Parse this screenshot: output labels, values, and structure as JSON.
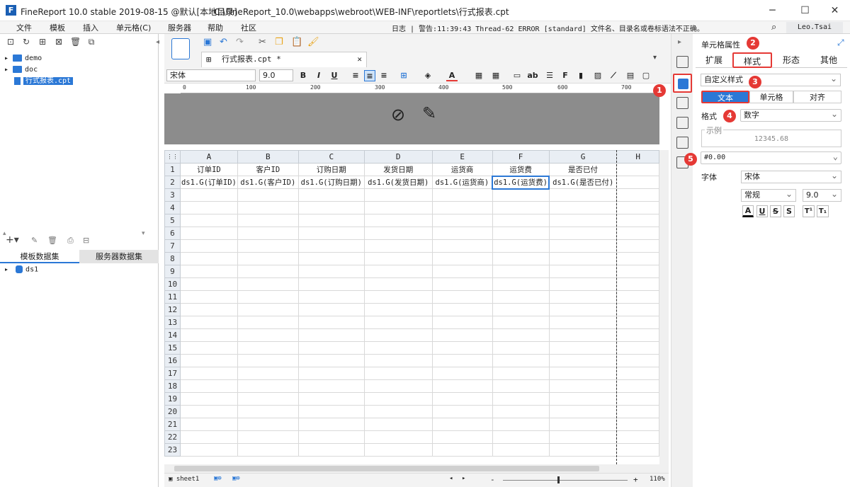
{
  "window": {
    "title": "FineReport 10.0 stable 2019-08-15 @默认[本地目录]",
    "path": "C:\\FineReport_10.0\\webapps\\webroot\\WEB-INF\\reportlets\\行式报表.cpt",
    "minimize": "─",
    "maximize": "☐",
    "close": "✕"
  },
  "menu": [
    "文件",
    "模板",
    "插入",
    "单元格(C)",
    "服务器",
    "帮助",
    "社区"
  ],
  "log": {
    "label": "日志",
    "message": "警告:11:39:43 Thread-62 ERROR [standard] 文件名、目录名或卷标语法不正确。"
  },
  "user": "Leo.Tsai",
  "tree": {
    "items": [
      {
        "label": "demo",
        "type": "folder"
      },
      {
        "label": "doc",
        "type": "folder"
      },
      {
        "label": "行式报表.cpt",
        "type": "file"
      }
    ]
  },
  "dataset_tabs": [
    "模板数据集",
    "服务器数据集"
  ],
  "datasets": [
    "ds1"
  ],
  "doc_tab": "行式报表.cpt *",
  "format_bar": {
    "font": "宋体",
    "size": "9.0"
  },
  "ruler_ticks": [
    "0",
    "100",
    "200",
    "300",
    "400",
    "500",
    "600",
    "700"
  ],
  "sheet": {
    "columns": [
      "A",
      "B",
      "C",
      "D",
      "E",
      "F",
      "G",
      "H"
    ],
    "row1": [
      "订单ID",
      "客户ID",
      "订购日期",
      "发货日期",
      "运货商",
      "运货费",
      "是否已付",
      ""
    ],
    "row2": [
      "ds1.G(订单ID)",
      "ds1.G(客户ID)",
      "ds1.G(订购日期)",
      "ds1.G(发货日期)",
      "ds1.G(运货商)",
      "ds1.G(运货费)",
      "ds1.G(是否已付)",
      ""
    ],
    "row_numbers": [
      "1",
      "2",
      "3",
      "4",
      "5",
      "6",
      "7",
      "8",
      "9",
      "10",
      "11",
      "12",
      "13",
      "14",
      "15",
      "16",
      "17",
      "18",
      "19",
      "20",
      "21",
      "22",
      "23"
    ],
    "selected_column": "F"
  },
  "status": {
    "sheet": "sheet1",
    "zoom": "110%",
    "minus": "-",
    "plus": "+"
  },
  "panel": {
    "title": "单元格属性",
    "tabs": [
      "扩展",
      "样式",
      "形态",
      "其他"
    ],
    "style_type": "自定义样式",
    "sub_tabs": [
      "文本",
      "单元格",
      "对齐"
    ],
    "format_label": "格式",
    "format_value": "数字",
    "example_label": "示例",
    "example_value": "12345.68",
    "pattern": "#0.00",
    "font_label": "字体",
    "font_value": "宋体",
    "font_style": "常规",
    "font_size": "9.0",
    "style_buttons": [
      "A",
      "U",
      "S",
      "S",
      "T¹",
      "T₁"
    ]
  },
  "badges": [
    "1",
    "2",
    "3",
    "4",
    "5"
  ],
  "colors": {
    "accent": "#2b78d6",
    "highlight": "#e53935"
  }
}
